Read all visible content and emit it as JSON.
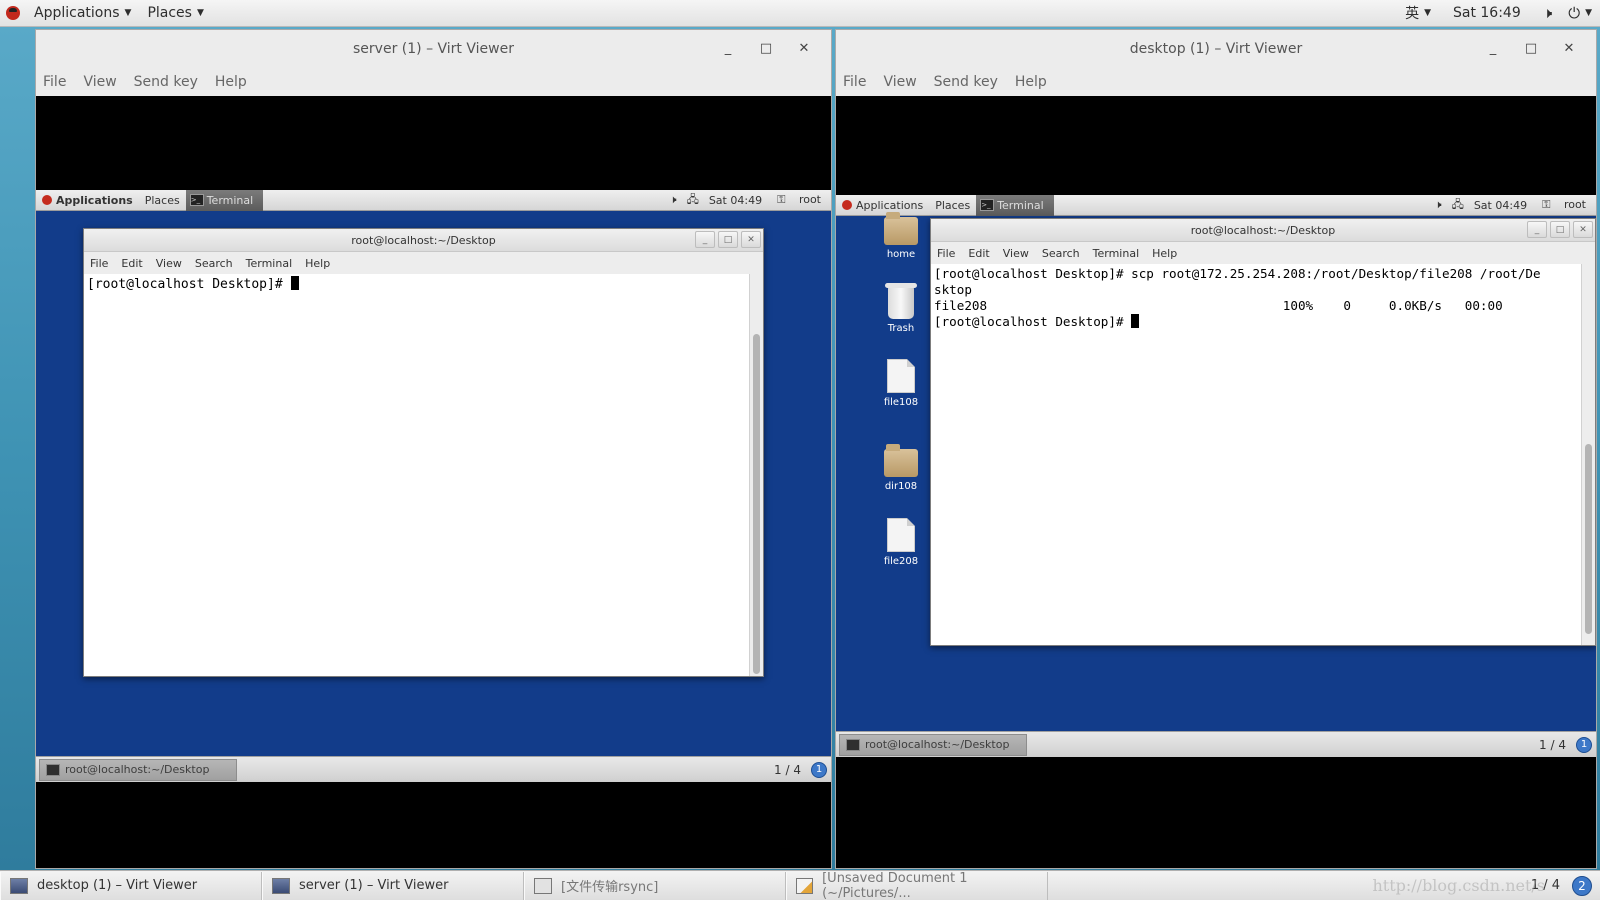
{
  "host": {
    "top_bar": {
      "applications": "Applications",
      "places": "Places",
      "input_method": "英",
      "clock": "Sat 16:49",
      "volume_icon": "speaker-icon",
      "power_icon": "power-icon"
    },
    "taskbar": {
      "items": [
        {
          "label": "desktop (1) – Virt Viewer",
          "icon": "virt-viewer-icon"
        },
        {
          "label": "server (1) – Virt Viewer",
          "icon": "virt-viewer-icon"
        },
        {
          "label": "[文件传输rsync]",
          "icon": "document-icon"
        },
        {
          "label": "[Unsaved Document 1 (~/Pictures/...",
          "icon": "text-editor-icon"
        }
      ],
      "watermark": "http://blog.csdn.net/s",
      "workspace": "1 / 4",
      "workspace_badge": "2"
    }
  },
  "server_window": {
    "title": "server (1) – Virt Viewer",
    "menu": [
      "File",
      "View",
      "Send key",
      "Help"
    ],
    "guest": {
      "top_bar": {
        "applications": "Applications",
        "places": "Places",
        "terminal": "Terminal",
        "clock": "Sat 04:49",
        "user": "root"
      },
      "terminal": {
        "title": "root@localhost:~/Desktop",
        "menu": [
          "File",
          "Edit",
          "View",
          "Search",
          "Terminal",
          "Help"
        ],
        "lines": [
          "[root@localhost Desktop]# "
        ]
      },
      "bottom_bar": {
        "task": "root@localhost:~/Desktop",
        "workspace": "1 / 4",
        "badge": "1"
      }
    }
  },
  "desktop_window": {
    "title": "desktop (1) – Virt Viewer",
    "menu": [
      "File",
      "View",
      "Send key",
      "Help"
    ],
    "guest": {
      "top_bar": {
        "applications": "Applications",
        "places": "Places",
        "terminal": "Terminal",
        "clock": "Sat 04:49",
        "user": "root"
      },
      "icons": [
        {
          "label": "home",
          "type": "folder"
        },
        {
          "label": "Trash",
          "type": "trash"
        },
        {
          "label": "file108",
          "type": "file"
        },
        {
          "label": "dir108",
          "type": "folder"
        },
        {
          "label": "file208",
          "type": "file"
        }
      ],
      "terminal": {
        "title": "root@localhost:~/Desktop",
        "menu": [
          "File",
          "Edit",
          "View",
          "Search",
          "Terminal",
          "Help"
        ],
        "lines": [
          "[root@localhost Desktop]# scp root@172.25.254.208:/root/Desktop/file208 /root/De",
          "sktop",
          "file208                                       100%    0     0.0KB/s   00:00",
          "[root@localhost Desktop]# "
        ]
      },
      "bottom_bar": {
        "task": "root@localhost:~/Desktop",
        "workspace": "1 / 4",
        "badge": "1"
      }
    }
  }
}
